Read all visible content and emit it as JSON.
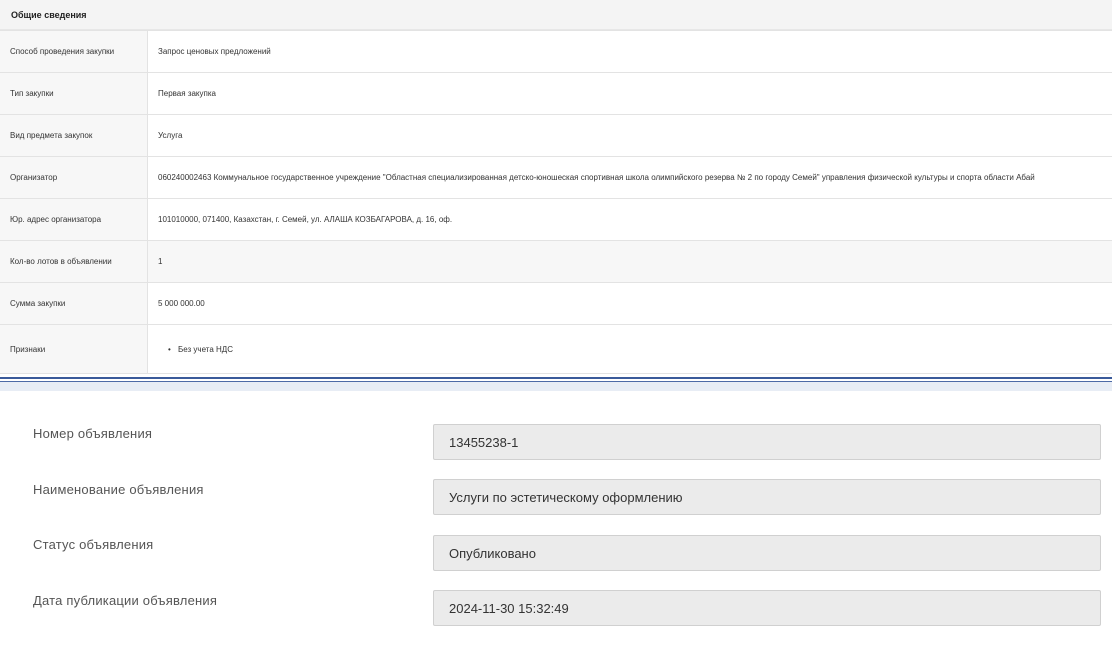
{
  "general": {
    "title": "Общие сведения",
    "rows": [
      {
        "label": "Способ проведения закупки",
        "value": "Запрос ценовых предложений"
      },
      {
        "label": "Тип закупки",
        "value": "Первая закупка"
      },
      {
        "label": "Вид предмета закупок",
        "value": "Услуга"
      },
      {
        "label": "Организатор",
        "value": "060240002463 Коммунальное государственное учреждение \"Областная специализированная детско-юношеская спортивная школа олимпийского резерва № 2 по городу Семей\" управления физической культуры и спорта области Абай"
      },
      {
        "label": "Юр. адрес организатора",
        "value": "101010000, 071400, Казахстан, г. Семей, ул. АЛАША КОЗБАГАРОВА, д. 16, оф."
      },
      {
        "label": "Кол-во лотов в объявлении",
        "value": "1"
      },
      {
        "label": "Сумма закупки",
        "value": "5 000 000.00"
      }
    ],
    "features_label": "Признаки",
    "features": [
      "Без учета НДС"
    ],
    "bullet": "•"
  },
  "announcement": {
    "fields": [
      {
        "label": "Номер объявления",
        "value": "13455238-1"
      },
      {
        "label": "Наименование объявления",
        "value": "Услуги по эстетическому оформлению"
      },
      {
        "label": "Статус объявления",
        "value": "Опубликовано"
      },
      {
        "label": "Дата публикации объявления",
        "value": "2024-11-30 15:32:49"
      }
    ]
  }
}
